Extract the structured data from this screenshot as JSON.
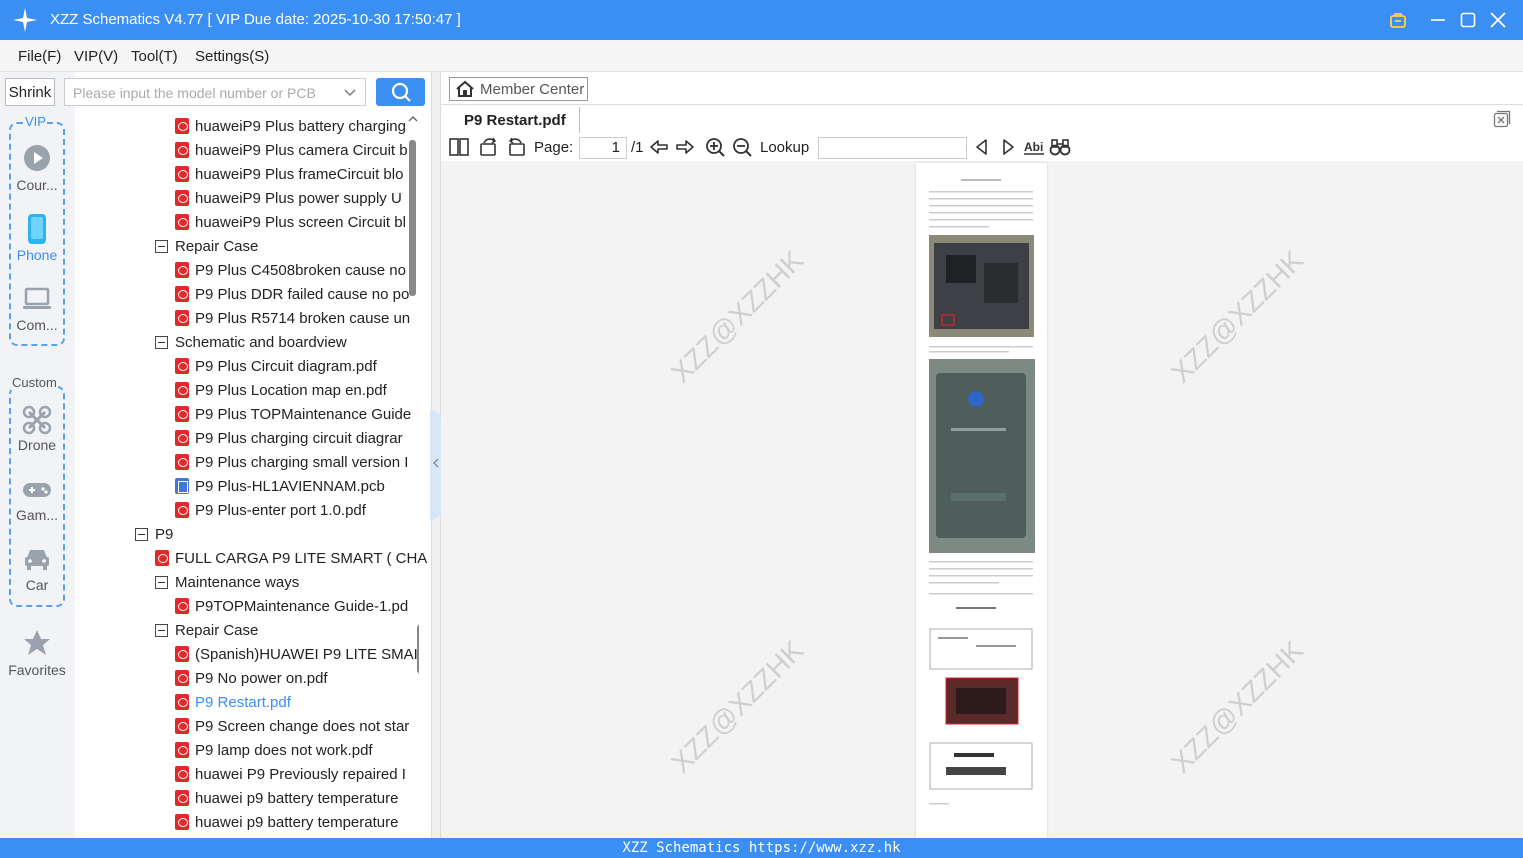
{
  "window": {
    "title": "XZZ Schematics V4.77 [ VIP Due date: 2025-10-30 17:50:47 ]"
  },
  "menu": [
    "File(F)",
    "VIP(V)",
    "Tool(T)",
    "Settings(S)"
  ],
  "search": {
    "shrink_label": "Shrink",
    "placeholder": "Please input the model number or PCB"
  },
  "nav": {
    "vip_label": "VIP",
    "custom_label": "Custom",
    "items": [
      "Cour...",
      "Phone",
      "Com...",
      "Drone",
      "Gam...",
      "Car",
      "Favorites"
    ],
    "active": "Phone"
  },
  "tree": [
    {
      "type": "pdf",
      "label": "huaweiP9 Plus battery charging",
      "level": 2
    },
    {
      "type": "pdf",
      "label": "huaweiP9 Plus camera Circuit b",
      "level": 2
    },
    {
      "type": "pdf",
      "label": "huaweiP9 Plus frameCircuit blo",
      "level": 2
    },
    {
      "type": "pdf",
      "label": "huaweiP9 Plus power supply U",
      "level": 2
    },
    {
      "type": "pdf",
      "label": "huaweiP9 Plus screen Circuit bl",
      "level": 2
    },
    {
      "type": "folder",
      "label": "Repair Case",
      "level": 1
    },
    {
      "type": "pdf",
      "label": "P9 Plus C4508broken cause no",
      "level": 2
    },
    {
      "type": "pdf",
      "label": "P9 Plus DDR failed cause no po",
      "level": 2
    },
    {
      "type": "pdf",
      "label": "P9 Plus R5714 broken cause un",
      "level": 2
    },
    {
      "type": "folder",
      "label": "Schematic and boardview",
      "level": 1
    },
    {
      "type": "pdf",
      "label": "P9 Plus Circuit diagram.pdf",
      "level": 2
    },
    {
      "type": "pdf",
      "label": "P9 Plus Location map en.pdf",
      "level": 2
    },
    {
      "type": "pdf",
      "label": "P9 Plus TOPMaintenance Guide",
      "level": 2
    },
    {
      "type": "pdf",
      "label": "P9 Plus charging circuit diagrar",
      "level": 2
    },
    {
      "type": "pdf",
      "label": "P9 Plus charging small version I",
      "level": 2
    },
    {
      "type": "pcb",
      "label": "P9 Plus-HL1AVIENNAM.pcb",
      "level": 2
    },
    {
      "type": "pdf",
      "label": "P9 Plus-enter port 1.0.pdf",
      "level": 2
    },
    {
      "type": "folder",
      "label": "P9",
      "level": 0
    },
    {
      "type": "pdf",
      "label": "FULL CARGA P9 LITE SMART ( CHA",
      "level": 1
    },
    {
      "type": "folder",
      "label": "Maintenance ways",
      "level": 1
    },
    {
      "type": "pdf",
      "label": "P9TOPMaintenance Guide-1.pd",
      "level": 2
    },
    {
      "type": "folder",
      "label": "Repair Case",
      "level": 1
    },
    {
      "type": "pdf",
      "label": "(Spanish)HUAWEI P9 LITE SMAI",
      "level": 2
    },
    {
      "type": "pdf",
      "label": "P9 No power on.pdf",
      "level": 2
    },
    {
      "type": "pdf",
      "label": "P9 Restart.pdf",
      "level": 2,
      "selected": true
    },
    {
      "type": "pdf",
      "label": "P9 Screen change does not star",
      "level": 2
    },
    {
      "type": "pdf",
      "label": "P9 lamp does not work.pdf",
      "level": 2
    },
    {
      "type": "pdf",
      "label": "huawei P9 Previously repaired I",
      "level": 2
    },
    {
      "type": "pdf",
      "label": "huawei p9 battery temperature",
      "level": 2
    },
    {
      "type": "pdf",
      "label": "huawei p9 battery temperature",
      "level": 2
    }
  ],
  "viewer": {
    "member_center": "Member Center",
    "tab_title": "P9 Restart.pdf",
    "page_label": "Page:",
    "page_current": "1",
    "page_total": "/1",
    "lookup_label": "Lookup",
    "watermark": "XZZ@XZZHK"
  },
  "status": {
    "text": "XZZ Schematics https://www.xzz.hk"
  },
  "colors": {
    "accent": "#3b8ef2",
    "selected_text": "#3b8ef2",
    "pdf_icon": "#e02a2a"
  }
}
